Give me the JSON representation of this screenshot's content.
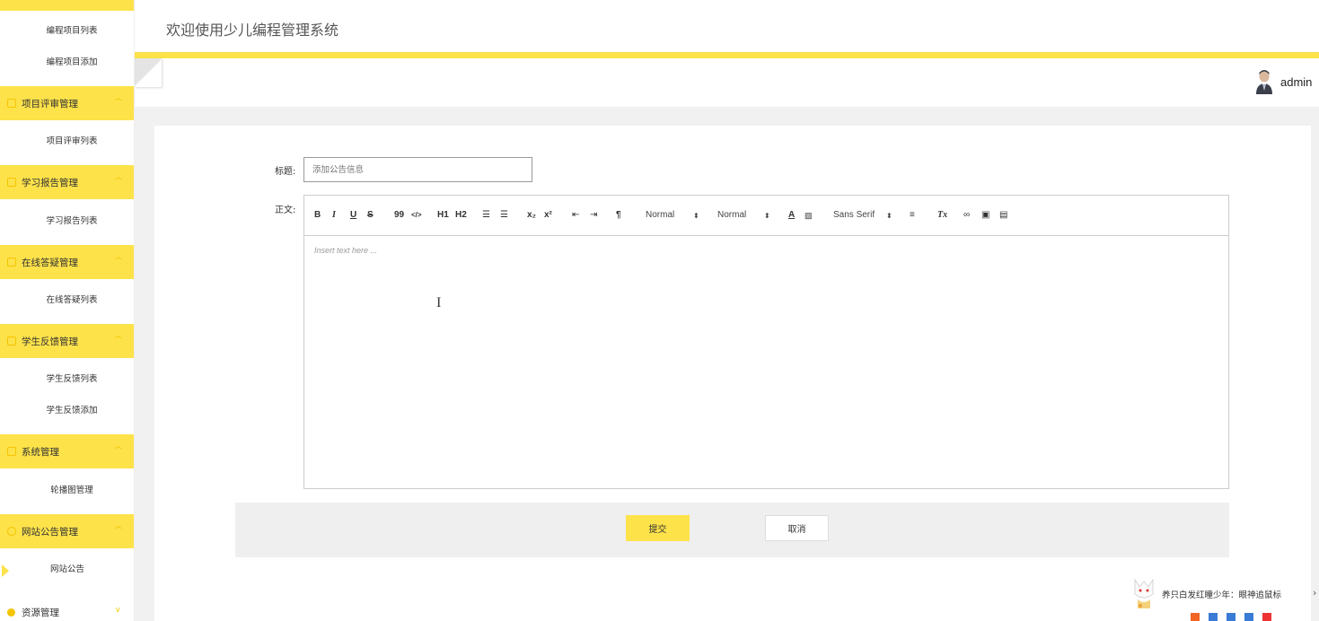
{
  "header": {
    "site_title": "欢迎使用少儿编程管理系统",
    "user_name": "admin"
  },
  "sidebar": {
    "items": [
      {
        "label": "编程项目列表"
      },
      {
        "label": "编程项目添加"
      },
      {
        "label": "项目评审管理",
        "group": true
      },
      {
        "label": "项目评审列表"
      },
      {
        "label": "学习报告管理",
        "group": true
      },
      {
        "label": "学习报告列表"
      },
      {
        "label": "在线答疑管理",
        "group": true
      },
      {
        "label": "在线答疑列表"
      },
      {
        "label": "学生反馈管理",
        "group": true
      },
      {
        "label": "学生反馈列表"
      },
      {
        "label": "学生反馈添加"
      },
      {
        "label": "系统管理",
        "group": true
      },
      {
        "label": "轮播图管理"
      },
      {
        "label": "网站公告管理",
        "group": true
      },
      {
        "label": "网站公告",
        "active": true
      },
      {
        "label": "资源管理",
        "group": true
      }
    ]
  },
  "form": {
    "title_label": "标题:",
    "title_placeholder": "添加公告信息",
    "body_label": "正文:",
    "editor_placeholder": "Insert text here ...",
    "toolbar": {
      "bold": "B",
      "italic": "I",
      "underline": "U",
      "strike": "S",
      "quote": "99",
      "code": "</>",
      "h1": "H1",
      "h2": "H2",
      "header_size": "Normal",
      "font_size": "Normal",
      "font_family": "Sans Serif"
    },
    "submit_label": "提交",
    "cancel_label": "取消"
  },
  "music_widget": {
    "text": "养只白发红瞳少年：眼神追鼠标"
  },
  "colors": {
    "accent": "#fde24a",
    "page_bg": "#f1f1f1"
  }
}
